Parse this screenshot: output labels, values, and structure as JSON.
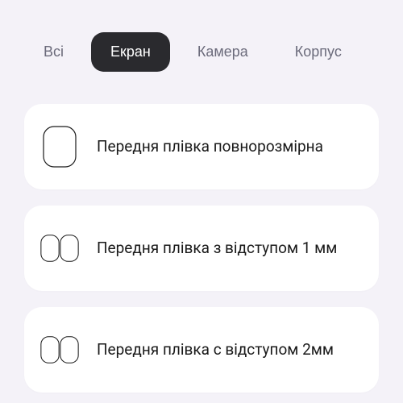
{
  "tabs": [
    {
      "id": "all",
      "label": "Всі",
      "active": false
    },
    {
      "id": "screen",
      "label": "Екран",
      "active": true
    },
    {
      "id": "camera",
      "label": "Камера",
      "active": false
    },
    {
      "id": "case",
      "label": "Корпус",
      "active": false
    }
  ],
  "options": [
    {
      "id": "front-full",
      "label": "Передня плівка повнорозмірна",
      "icon": "single-rect"
    },
    {
      "id": "front-1mm",
      "label": "Передня плівка з відступом 1 мм",
      "icon": "double-rect"
    },
    {
      "id": "front-2mm",
      "label": "Передня плівка с відступом 2мм",
      "icon": "double-rect"
    }
  ]
}
